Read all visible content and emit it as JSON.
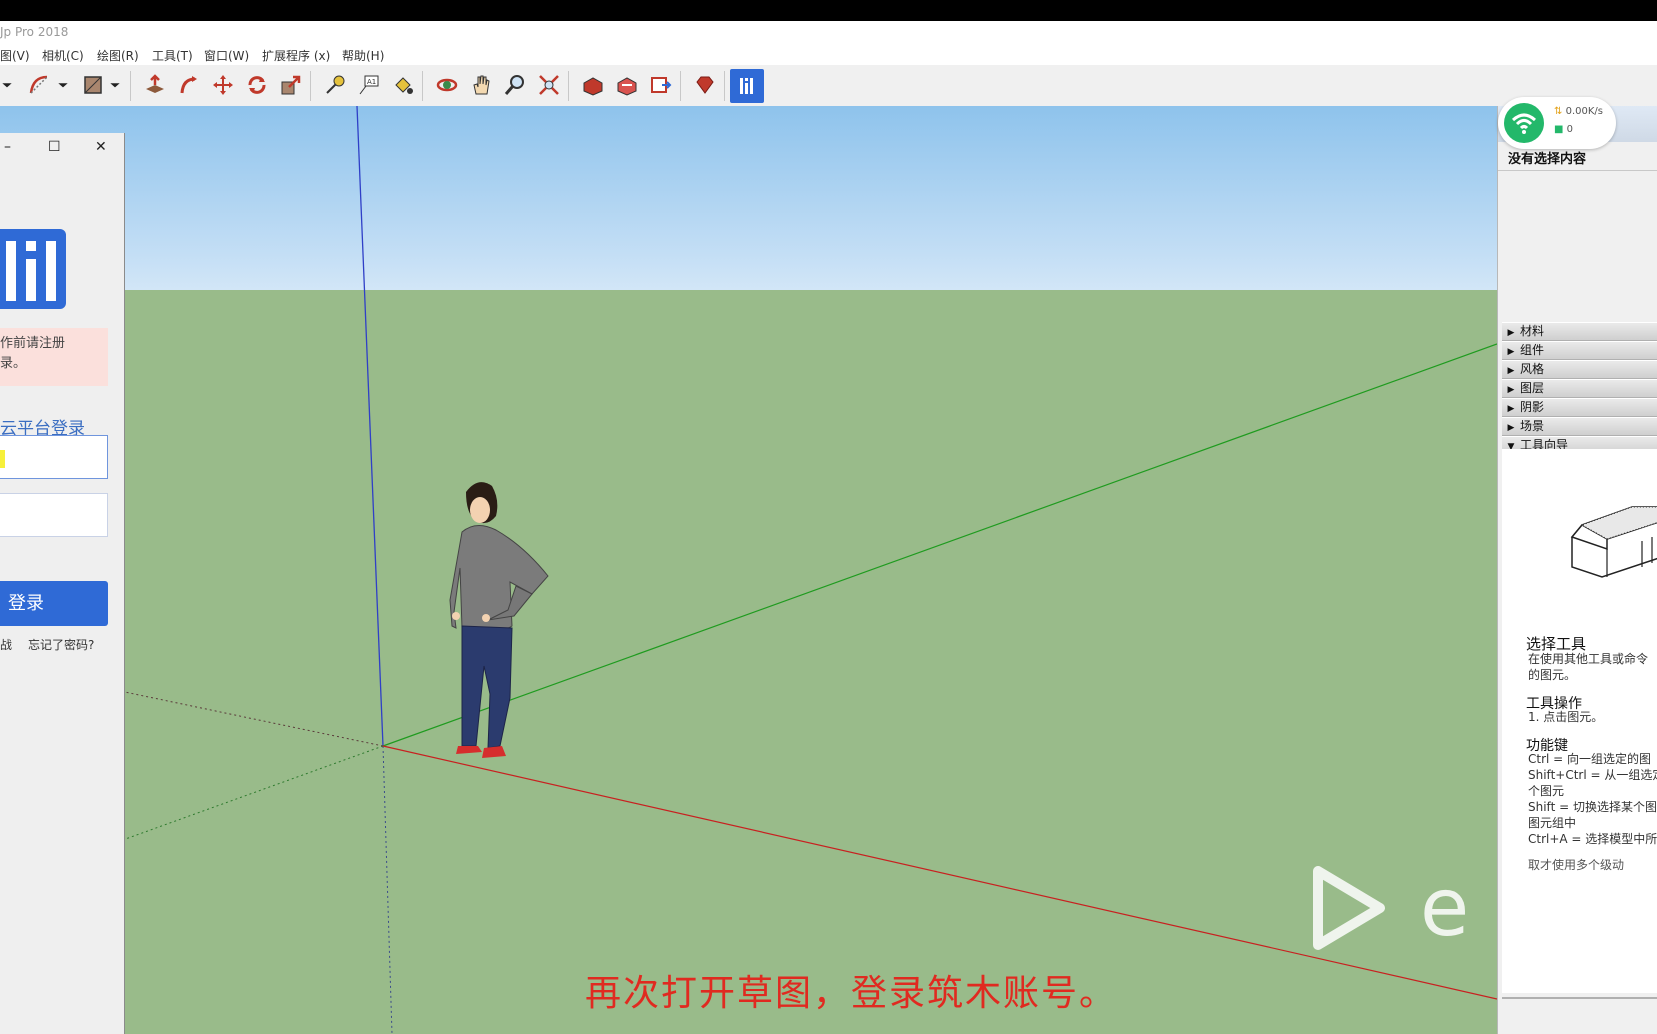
{
  "window": {
    "title": "Jp Pro 2018"
  },
  "menu": [
    {
      "label": "图(V)"
    },
    {
      "label": "相机(C)"
    },
    {
      "label": "绘图(R)"
    },
    {
      "label": "工具(T)"
    },
    {
      "label": "窗口(W)"
    },
    {
      "label": "扩展程序 (x)"
    },
    {
      "label": "帮助(H)"
    }
  ],
  "toolbar": {
    "icons": [
      "dropdown-arrow-icon",
      "arc-tool-icon",
      "dropdown-arrow-icon",
      "shape-tool-icon",
      "dropdown-arrow-icon",
      "push-pull-icon",
      "follow-me-icon",
      "move-icon",
      "rotate-icon",
      "scale-icon",
      "tape-measure-icon",
      "text-tool-icon",
      "paint-bucket-icon",
      "orbit-icon",
      "pan-icon",
      "zoom-icon",
      "zoom-extents-icon",
      "warehouse-icon",
      "extension-warehouse-icon",
      "layout-icon",
      "ruby-icon",
      "zhumu-plugin-icon"
    ]
  },
  "login": {
    "minimize": "–",
    "maximize": "☐",
    "close": "✕",
    "warn_line1": "作前请注册",
    "warn_line2": "录。",
    "platform": "云平台登录",
    "login_button": "登录",
    "link_left": "战",
    "link_forgot": "忘记了密码?"
  },
  "viewport": {
    "caption": "再次打开草图，登录筑木账号。",
    "watermark_text": "e",
    "sky_color": "#b9d9f3",
    "ground_color": "#99bb8a"
  },
  "net": {
    "speed": "0.00K/s",
    "count": "0"
  },
  "entity_info": {
    "no_selection": "没有选择内容"
  },
  "trays": [
    {
      "arrow": "▶",
      "label": "材料"
    },
    {
      "arrow": "▶",
      "label": "组件"
    },
    {
      "arrow": "▶",
      "label": "风格"
    },
    {
      "arrow": "▶",
      "label": "图层"
    },
    {
      "arrow": "▶",
      "label": "阴影"
    },
    {
      "arrow": "▶",
      "label": "场景"
    },
    {
      "arrow": "▼",
      "label": "工具向导"
    }
  ],
  "instructor": {
    "title": "选择工具",
    "desc1": "在使用其他工具或命令",
    "desc2": "的图元。",
    "ops_title": "工具操作",
    "op1": "1. 点击图元。",
    "keys_title": "功能键",
    "k1": "Ctrl = 向一组选定的图",
    "k2": "Shift+Ctrl = 从一组选定",
    "k3": "个图元",
    "k4": "Shift = 切换选择某个图",
    "k5": "图元组中",
    "k6": "Ctrl+A = 选择模型中所",
    "k7": "取才使用多个级动"
  }
}
